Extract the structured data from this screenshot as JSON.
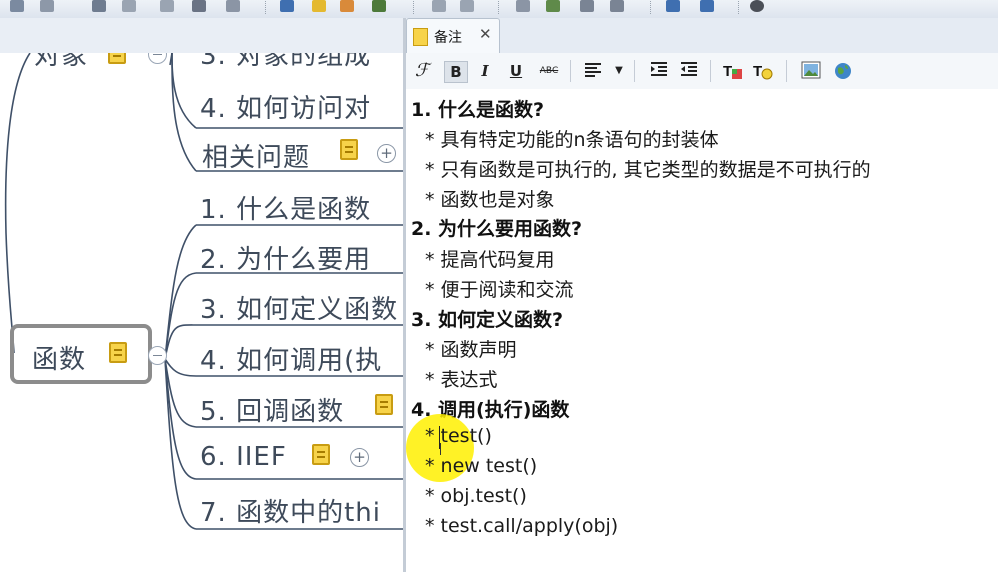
{
  "toolbar": {
    "icons": [
      "toolbar-icons"
    ]
  },
  "mindmap": {
    "top_node": "对象",
    "top_child_cut": "3. 对象的组成",
    "obj_items": [
      "4. 如何访问对",
      "相关问题"
    ],
    "func_node": "函数",
    "func_items": [
      "1. 什么是函数",
      "2. 为什么要用",
      "3. 如何定义函数",
      "4. 如何调用(执",
      "5. 回调函数",
      "6. IIEF",
      "7. 函数中的thi"
    ]
  },
  "notes_panel": {
    "tab_label": "备注",
    "close_glyph": "✕"
  },
  "format_bar": {
    "font": "ℱ",
    "bold": "B",
    "italic": "I",
    "underline": "U",
    "strike": "ABC"
  },
  "notes": {
    "s1_title": "1. 什么是函数?",
    "s1_items": [
      "* 具有特定功能的n条语句的封装体",
      "* 只有函数是可执行的, 其它类型的数据是不可执行的",
      "* 函数也是对象"
    ],
    "s2_title": "2. 为什么要用函数?",
    "s2_items": [
      "* 提高代码复用",
      "* 便于阅读和交流"
    ],
    "s3_title": "3. 如何定义函数?",
    "s3_items": [
      "* 函数声明",
      "* 表达式"
    ],
    "s4_title": "4. 调用(执行)函数",
    "s4_items": [
      "* test()",
      "* new test()",
      "* obj.test()",
      "* test.call/apply(obj)"
    ]
  }
}
